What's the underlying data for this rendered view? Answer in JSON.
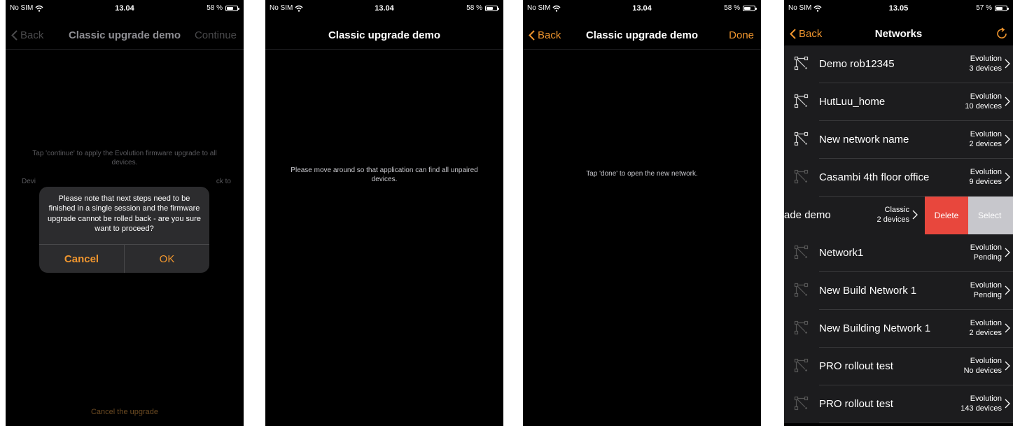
{
  "screens": [
    {
      "status": {
        "carrier": "No SIM",
        "time": "13.04",
        "battery": "58 %"
      },
      "nav": {
        "back": "Back",
        "title": "Classic upgrade demo",
        "right": "Continue"
      },
      "message_1": "Tap 'continue' to apply the Evolution firmware upgrade to all devices.",
      "message_2_left": "Devi",
      "message_2_right": "ck to",
      "dialog": {
        "message": "Please note that next steps need to be finished in a single session and the firmware upgrade cannot be rolled back - are you sure want to proceed?",
        "cancel": "Cancel",
        "ok": "OK"
      },
      "footer_link": "Cancel the upgrade"
    },
    {
      "status": {
        "carrier": "No SIM",
        "time": "13.04",
        "battery": "58 %"
      },
      "nav": {
        "title": "Classic upgrade demo"
      },
      "message": "Please move around so that application can find all unpaired devices."
    },
    {
      "status": {
        "carrier": "No SIM",
        "time": "13.04",
        "battery": "58 %"
      },
      "nav": {
        "back": "Back",
        "title": "Classic upgrade demo",
        "right": "Done"
      },
      "message": "Tap 'done' to open the new network."
    },
    {
      "status": {
        "carrier": "No SIM",
        "time": "13.05",
        "battery": "57 %"
      },
      "nav": {
        "back": "Back",
        "title": "Networks"
      },
      "networks": [
        {
          "name": "Demo rob12345",
          "type": "Evolution",
          "devices": "3 devices"
        },
        {
          "name": "HutLuu_home",
          "type": "Evolution",
          "devices": "10 devices"
        },
        {
          "name": "New network name",
          "type": "Evolution",
          "devices": "2 devices"
        },
        {
          "name": "Casambi 4th floor office",
          "type": "Evolution",
          "devices": "9 devices"
        },
        {
          "name": "ade demo",
          "type": "Classic",
          "devices": "2 devices",
          "delete": "Delete",
          "select": "Select"
        },
        {
          "name": "Network1",
          "type": "Evolution",
          "devices": "Pending"
        },
        {
          "name": "New Build Network 1",
          "type": "Evolution",
          "devices": "Pending"
        },
        {
          "name": "New Building Network 1",
          "type": "Evolution",
          "devices": "2 devices"
        },
        {
          "name": "PRO rollout test",
          "type": "Evolution",
          "devices": "No devices"
        },
        {
          "name": "PRO rollout test",
          "type": "Evolution",
          "devices": "143 devices"
        }
      ]
    }
  ],
  "colors": {
    "accent": "#f0962e",
    "delete": "#e8473d",
    "select": "#c7c7cc",
    "row_bg": "#1c1c1e"
  }
}
